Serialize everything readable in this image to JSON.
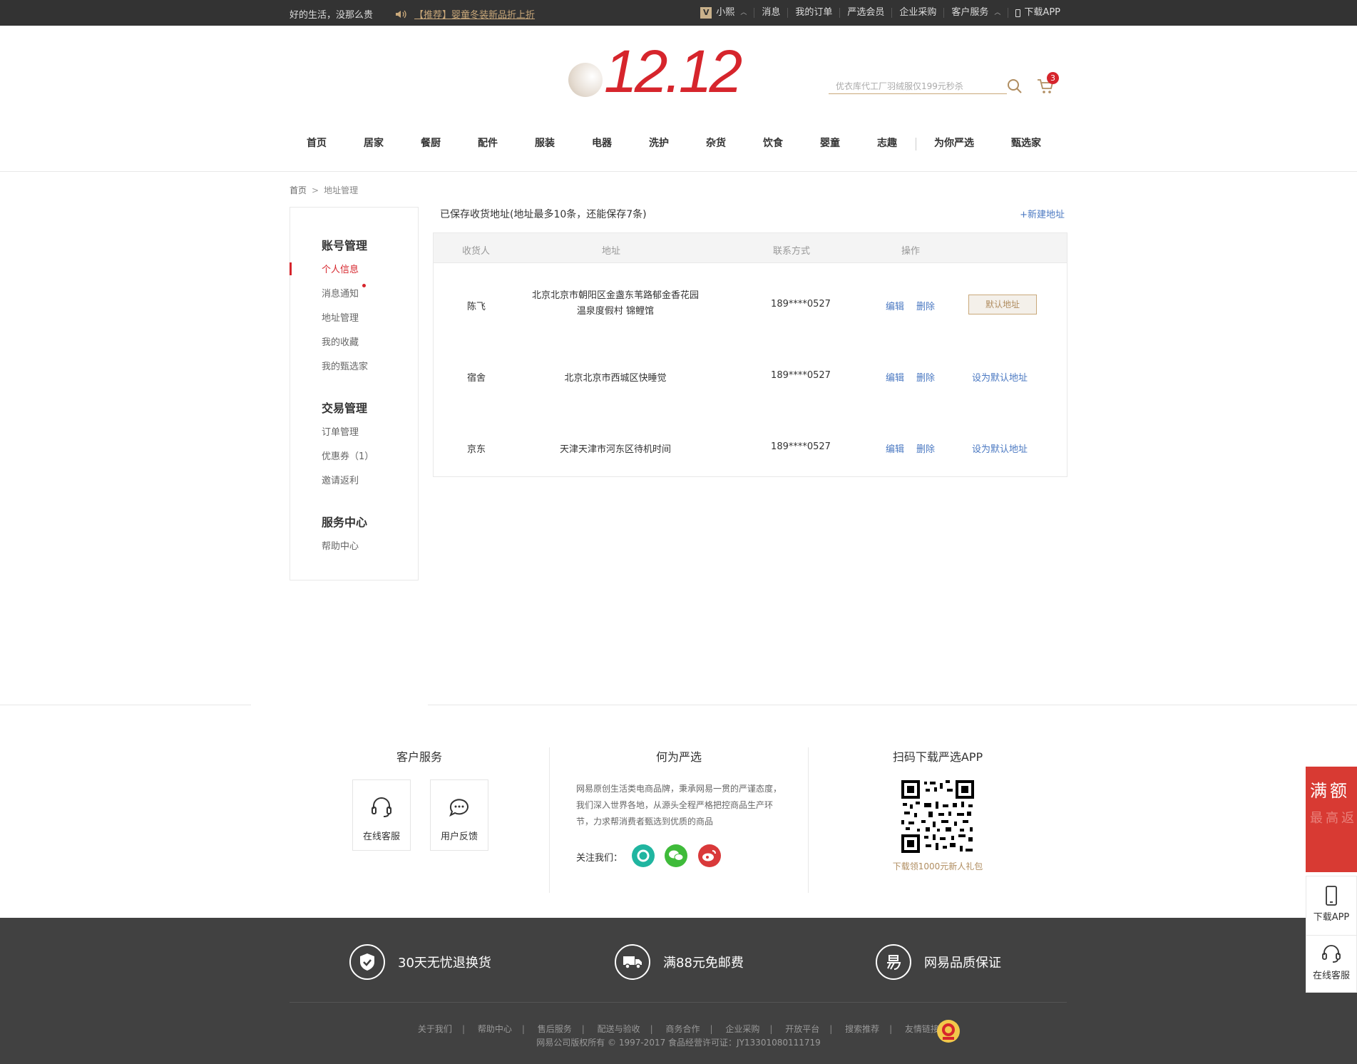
{
  "topbar": {
    "slogan": "好的生活，没那么贵",
    "promo": "【推荐】婴童冬装新品折上折",
    "user": "小熙",
    "vip": "V",
    "links": [
      "消息",
      "我的订单",
      "严选会员",
      "企业采购",
      "客户服务",
      "下载APP"
    ]
  },
  "header": {
    "logo_text": "12.12",
    "search_placeholder": "优衣库代工厂羽绒服仅199元秒杀",
    "cart_count": "3"
  },
  "nav": [
    "首页",
    "居家",
    "餐厨",
    "配件",
    "服装",
    "电器",
    "洗护",
    "杂货",
    "饮食",
    "婴童",
    "志趣",
    "为你严选",
    "甄选家"
  ],
  "breadcrumb": {
    "home": "首页",
    "sep": ">",
    "current": "地址管理"
  },
  "sidebar": {
    "groups": [
      {
        "title": "账号管理",
        "items": [
          "个人信息",
          "消息通知",
          "地址管理",
          "我的收藏",
          "我的甄选家"
        ]
      },
      {
        "title": "交易管理",
        "items": [
          "订单管理",
          "优惠券（1）",
          "邀请返利"
        ]
      },
      {
        "title": "服务中心",
        "items": [
          "帮助中心"
        ]
      }
    ]
  },
  "content": {
    "heading": "已保存收货地址(地址最多10条，还能保存7条)",
    "new_address": "+新建地址",
    "columns": [
      "收货人",
      "地址",
      "联系方式",
      "操作"
    ],
    "rows": [
      {
        "name": "陈飞",
        "address_line1": "北京北京市朝阳区金盏东苇路郁金香花园",
        "address_line2": "温泉度假村 锦鲤馆",
        "phone": "189****0527",
        "edit": "编辑",
        "delete": "删除",
        "action": "默认地址",
        "is_default": true
      },
      {
        "name": "宿舍",
        "address_line1": "北京北京市西城区快睡觉",
        "address_line2": "",
        "phone": "189****0527",
        "edit": "编辑",
        "delete": "删除",
        "action": "设为默认地址",
        "is_default": false
      },
      {
        "name": "京东",
        "address_line1": "天津天津市河东区待机时间",
        "address_line2": "",
        "phone": "189****0527",
        "edit": "编辑",
        "delete": "删除",
        "action": "设为默认地址",
        "is_default": false
      }
    ]
  },
  "footer": {
    "service_title": "客户服务",
    "online_service": "在线客服",
    "feedback": "用户反馈",
    "about_title": "何为严选",
    "about_text": "网易原创生活类电商品牌，秉承网易一贯的严谨态度，我们深入世界各地，从源头全程严格把控商品生产环节，力求帮消费者甄选到优质的商品",
    "follow": "关注我们：",
    "app_title": "扫码下载严选APP",
    "app_caption": "下载领1000元新人礼包",
    "promises": [
      "30天无忧退换货",
      "满88元免邮费",
      "网易品质保证"
    ],
    "links": [
      "关于我们",
      "帮助中心",
      "售后服务",
      "配送与验收",
      "商务合作",
      "企业采购",
      "开放平台",
      "搜索推荐",
      "友情链接"
    ],
    "copyright": "网易公司版权所有 © 1997-2017   食品经营许可证：JY13301080111719"
  },
  "float": {
    "banner_line1": "满额",
    "banner_line2": "最高返",
    "download": "下载APP",
    "service": "在线客服"
  },
  "colors": {
    "accent": "#d6252c",
    "gold": "#c9a87a",
    "link": "#4b79c2",
    "topbar": "#333333",
    "bottombar": "#414141"
  }
}
